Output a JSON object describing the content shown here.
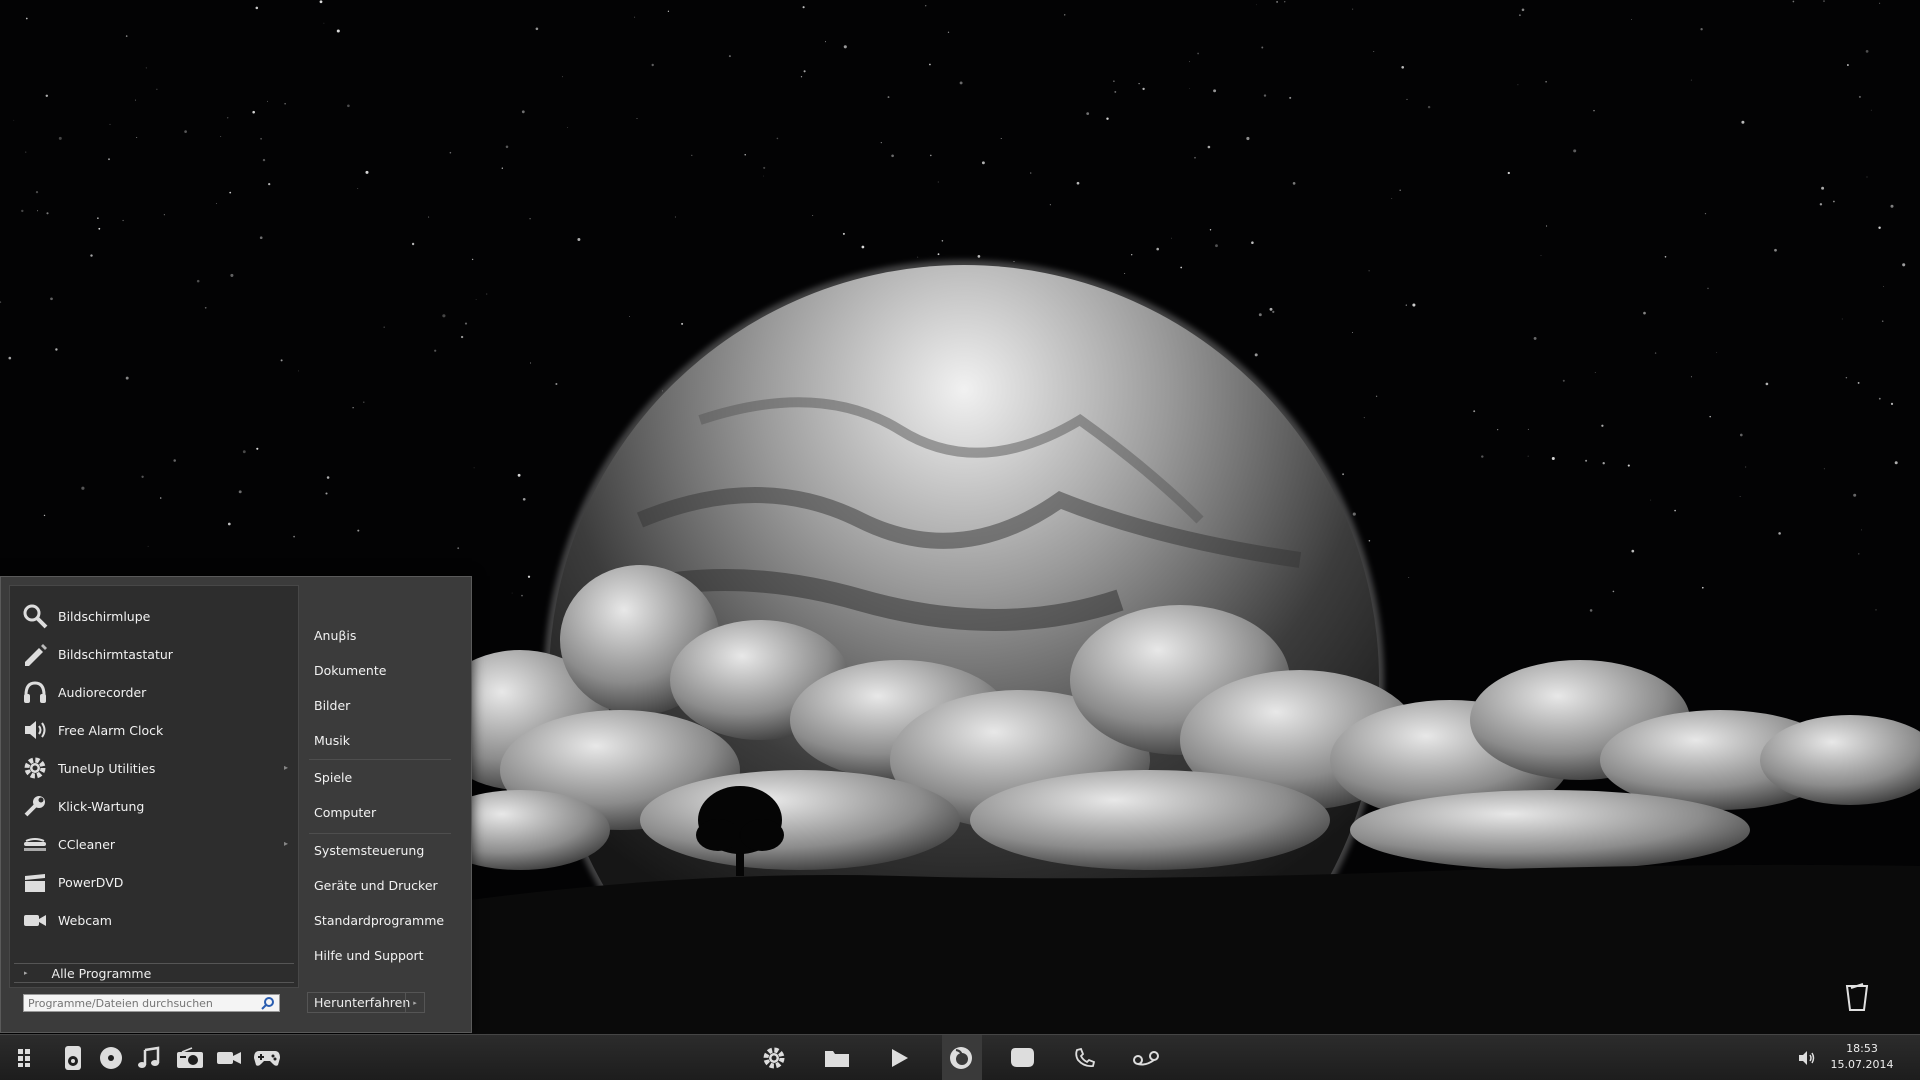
{
  "start_menu": {
    "programs": [
      {
        "label": "Bildschirmlupe",
        "icon": "magnifier-icon",
        "has_submenu": false
      },
      {
        "label": "Bildschirmtastatur",
        "icon": "keyboard-pen-icon",
        "has_submenu": false
      },
      {
        "label": "Audiorecorder",
        "icon": "headphones-icon",
        "has_submenu": false
      },
      {
        "label": "Free Alarm Clock",
        "icon": "speaker-icon",
        "has_submenu": false
      },
      {
        "label": "TuneUp Utilities",
        "icon": "gear-icon",
        "has_submenu": true
      },
      {
        "label": "Klick-Wartung",
        "icon": "wrench-icon",
        "has_submenu": false
      },
      {
        "label": "CCleaner",
        "icon": "ccleaner-icon",
        "has_submenu": true
      },
      {
        "label": "PowerDVD",
        "icon": "dvd-icon",
        "has_submenu": false
      },
      {
        "label": "Webcam",
        "icon": "camera-icon",
        "has_submenu": false
      }
    ],
    "all_programs": "Alle Programme",
    "search_placeholder": "Programme/Dateien durchsuchen",
    "places": [
      "Anuβis",
      "Dokumente",
      "Bilder",
      "Musik",
      "Spiele",
      "Computer",
      "Systemsteuerung",
      "Geräte und Drucker",
      "Standardprogramme",
      "Hilfe und Support"
    ],
    "shutdown": "Herunterfahren"
  },
  "taskbar": {
    "left_icons": [
      "windows-start-icon",
      "ipod-icon",
      "disc-icon",
      "music-note-icon",
      "radio-icon",
      "video-camera-icon",
      "gamepad-icon"
    ],
    "center_icons": [
      "settings-gear-icon",
      "folder-icon",
      "play-icon",
      "firefox-icon",
      "chat-bubble-icon",
      "phone-icon",
      "voicemail-icon"
    ],
    "tray": {
      "volume_icon": "volume-icon",
      "time": "18:53",
      "date": "15.07.2014"
    }
  },
  "desktop": {
    "recycle_bin_icon": "recycle-bin-icon"
  }
}
